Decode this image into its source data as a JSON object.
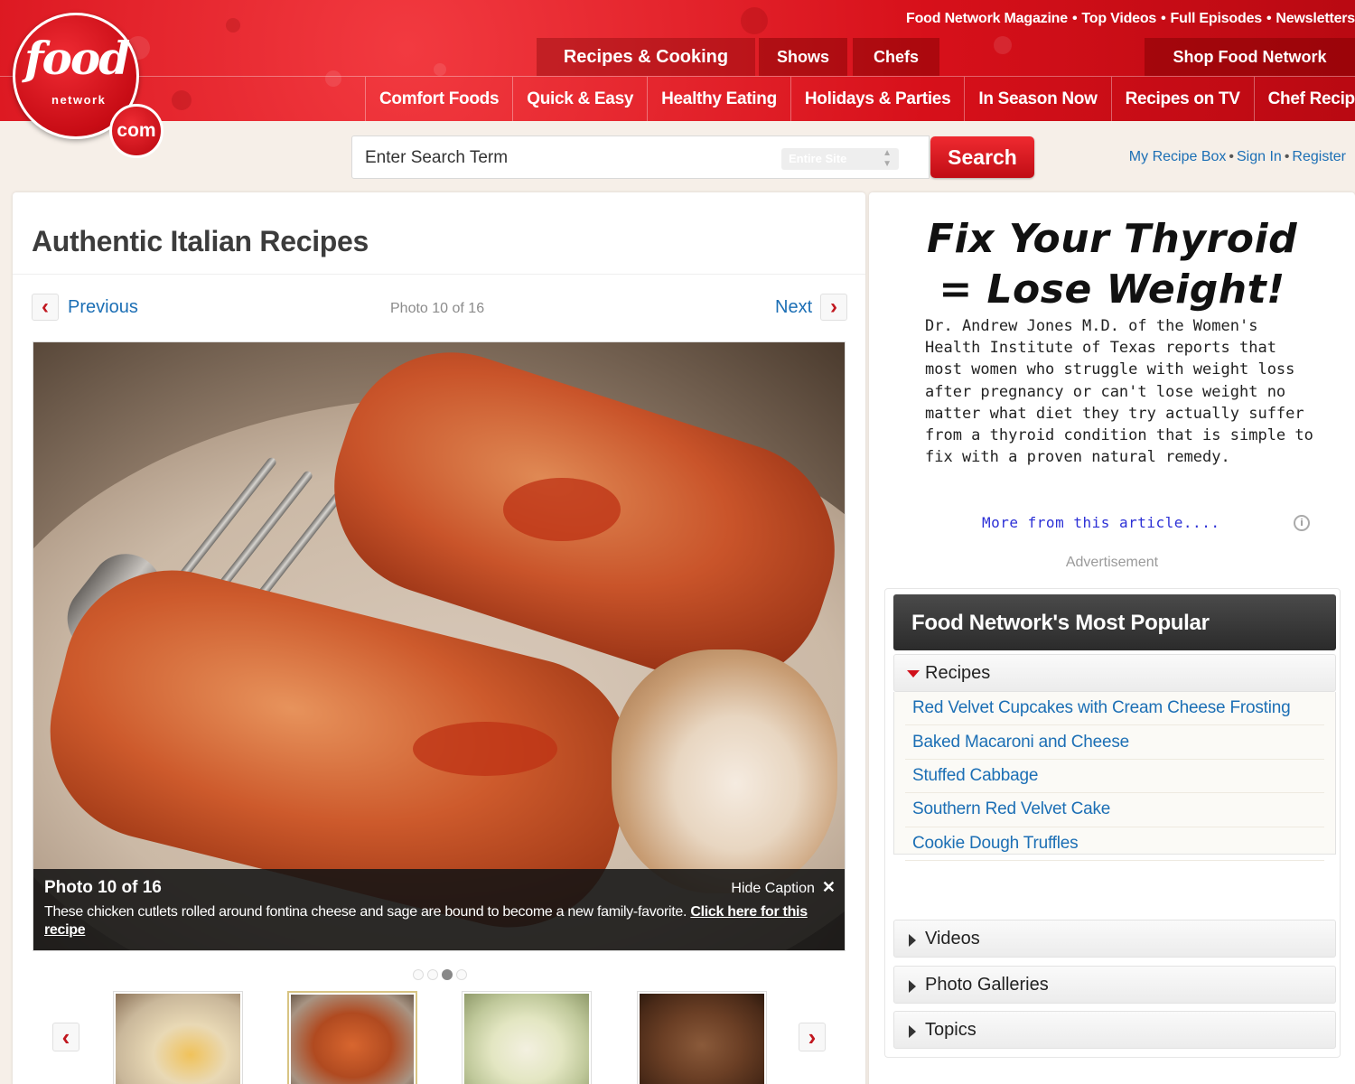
{
  "header": {
    "logo": {
      "word": "food",
      "sub": "network",
      "com": "com"
    },
    "utility_links": [
      "Food Network Magazine",
      "Top Videos",
      "Full Episodes",
      "Newsletters"
    ],
    "main_tabs": [
      "Recipes & Cooking",
      "Shows",
      "Chefs"
    ],
    "shop_link": "Shop Food Network",
    "sub_nav": [
      "Comfort Foods",
      "Quick & Easy",
      "Healthy Eating",
      "Holidays & Parties",
      "In Season Now",
      "Recipes on TV",
      "Chef Recipes"
    ],
    "active_tab": "Recipes & Cooking"
  },
  "search": {
    "placeholder": "Enter Search Term",
    "scope": "Entire Site",
    "button": "Search"
  },
  "account": {
    "recipe_box": "My Recipe Box",
    "sign_in": "Sign In",
    "register": "Register"
  },
  "gallery": {
    "title": "Authentic Italian Recipes",
    "prev": "Previous",
    "next": "Next",
    "counter": "Photo 10 of 16",
    "caption_title": "Photo 10 of 16",
    "caption_text": "These chicken cutlets rolled around fontina cheese and sage are bound to become a new family-favorite.",
    "caption_link": "Click here for this recipe",
    "hide_caption": "Hide Caption",
    "pager_dots": 4,
    "active_dot": 3,
    "thumbnails": [
      "pasta-dish",
      "chicken-rolls",
      "salad-plates",
      "braised-meat"
    ],
    "selected_thumbnail": 2
  },
  "ad": {
    "headline_1": "Fix Your Thyroid",
    "headline_2": "= Lose Weight!",
    "body": "Dr. Andrew Jones M.D. of the Women's Health Institute of Texas reports that most women who struggle with weight loss after pregnancy or can't lose weight no matter what diet they try actually suffer from a thyroid condition that is simple to fix with a proven natural remedy.",
    "more": "More from this article....",
    "label": "Advertisement"
  },
  "popular": {
    "title": "Food Network's Most Popular",
    "sections": {
      "recipes": "Recipes",
      "videos": "Videos",
      "galleries": "Photo Galleries",
      "topics": "Topics"
    },
    "recipes": [
      "Red Velvet Cupcakes with Cream Cheese Frosting",
      "Baked Macaroni and Cheese",
      "Stuffed Cabbage",
      "Southern Red Velvet Cake",
      "Cookie Dough Truffles"
    ]
  },
  "colors": {
    "brand_red": "#d7101a",
    "link_blue": "#1c6fb5",
    "ad_link": "#2c30d6"
  }
}
